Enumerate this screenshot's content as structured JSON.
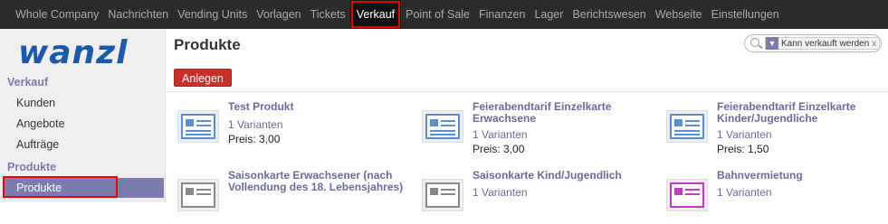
{
  "topnav": {
    "items": [
      {
        "label": "Whole Company",
        "active": false
      },
      {
        "label": "Nachrichten",
        "active": false
      },
      {
        "label": "Vending Units",
        "active": false
      },
      {
        "label": "Vorlagen",
        "active": false
      },
      {
        "label": "Tickets",
        "active": false
      },
      {
        "label": "Verkauf",
        "active": true
      },
      {
        "label": "Point of Sale",
        "active": false
      },
      {
        "label": "Finanzen",
        "active": false
      },
      {
        "label": "Lager",
        "active": false
      },
      {
        "label": "Berichtswesen",
        "active": false
      },
      {
        "label": "Webseite",
        "active": false
      },
      {
        "label": "Einstellungen",
        "active": false
      }
    ]
  },
  "sidebar": {
    "logo": "wanzl",
    "section_sales": "Verkauf",
    "items_sales": [
      "Kunden",
      "Angebote",
      "Aufträge"
    ],
    "section_products": "Produkte",
    "active_item": "Produkte"
  },
  "main": {
    "title": "Produkte",
    "create_label": "Anlegen",
    "search": {
      "facet_label": "Kann verkauft werden",
      "facet_remove": "x"
    },
    "products": [
      {
        "name": "Test Produkt",
        "variants": "1 Varianten",
        "price": "Preis: 3,00"
      },
      {
        "name": "Feierabendtarif Einzelkarte Erwachsene",
        "variants": "1 Varianten",
        "price": "Preis: 3,00"
      },
      {
        "name": "Feierabendtarif Einzelkarte Kinder/Jugendliche",
        "variants": "1 Varianten",
        "price": "Preis: 1,50"
      },
      {
        "name": "Saisonkarte Erwachsener (nach Vollendung des 18. Lebensjahres)",
        "variants": "",
        "price": ""
      },
      {
        "name": "Saisonkarte Kind/Jugendlich",
        "variants": "1 Varianten",
        "price": ""
      },
      {
        "name": "Bahnvermietung",
        "variants": "1 Varianten",
        "price": ""
      }
    ]
  },
  "colors": {
    "accent": "#7c7bad",
    "topbar": "#2b2b2b",
    "create_button": "#c9302c",
    "highlight": "#e00000"
  }
}
